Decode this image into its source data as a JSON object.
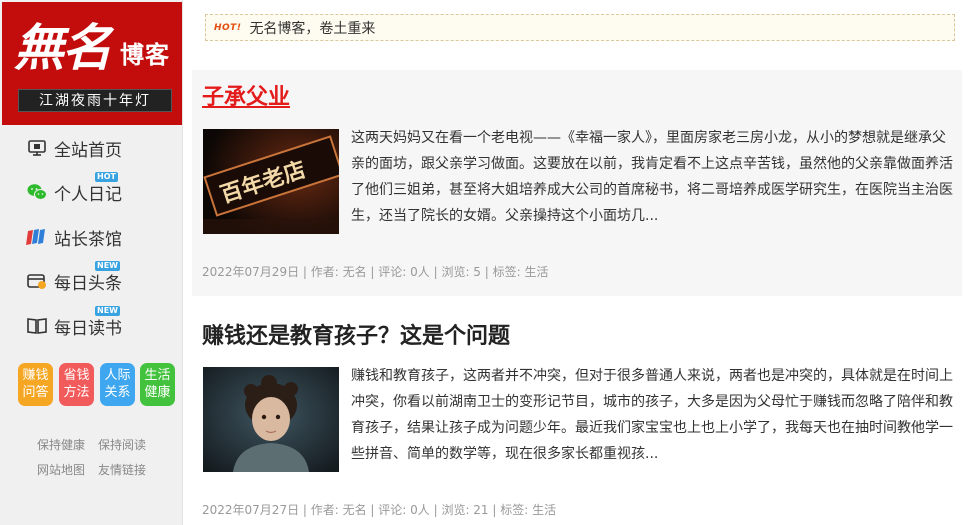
{
  "logo": {
    "big_text": "無名",
    "small_text": "博客",
    "slogan": "江湖夜雨十年灯"
  },
  "nav": [
    {
      "label": "全站首页",
      "icon": "monitor-icon",
      "badge": ""
    },
    {
      "label": "个人日记",
      "icon": "wechat-icon",
      "badge": "HOT"
    },
    {
      "label": "站长茶馆",
      "icon": "books-icon",
      "badge": ""
    },
    {
      "label": "每日头条",
      "icon": "card-icon",
      "badge": "NEW"
    },
    {
      "label": "每日读书",
      "icon": "book-icon",
      "badge": "NEW"
    }
  ],
  "categories": [
    {
      "line1": "赚钱",
      "line2": "问答",
      "color": "#f5a623"
    },
    {
      "line1": "省钱",
      "line2": "方法",
      "color": "#f25b5b"
    },
    {
      "line1": "人际",
      "line2": "关系",
      "color": "#3fa7ef"
    },
    {
      "line1": "生活",
      "line2": "健康",
      "color": "#43c23d"
    }
  ],
  "footer_links": [
    "保持健康",
    "保持阅读",
    "网站地图",
    "友情链接"
  ],
  "notice": {
    "badge": "HOT!",
    "text": "无名博客，卷土重来"
  },
  "articles": [
    {
      "title": "子承父业",
      "excerpt": "这两天妈妈又在看一个老电视——《幸福一家人》，里面房家老三房小龙，从小的梦想就是继承父亲的面坊，跟父亲学习做面。这要放在以前，我肯定看不上这点辛苦钱，虽然他的父亲靠做面养活了他们三姐弟，甚至将大姐培养成大公司的首席秘书，将二哥培养成医学研究生，在医院当主治医生，还当了院长的女婿。父亲操持这个小面坊几...",
      "thumb_text": "百年老店",
      "meta": "2022年07月29日 | 作者: 无名 | 评论: 0人 | 浏览: 5 | 标签: 生活"
    },
    {
      "title": "赚钱还是教育孩子？这是个问题",
      "excerpt": "赚钱和教育孩子，这两者并不冲突，但对于很多普通人来说，两者也是冲突的，具体就是在时间上冲突，你看以前湖南卫士的变形记节目，城市的孩子，大多是因为父母忙于赚钱而忽略了陪伴和教育孩子，结果让孩子成为问题少年。最近我们家宝宝也上也上小学了，我每天也在抽时间教他学一些拼音、简单的数学等，现在很多家长都重视孩...",
      "meta": "2022年07月27日 | 作者: 无名 | 评论: 0人 | 浏览: 21 | 标签: 生活"
    }
  ]
}
